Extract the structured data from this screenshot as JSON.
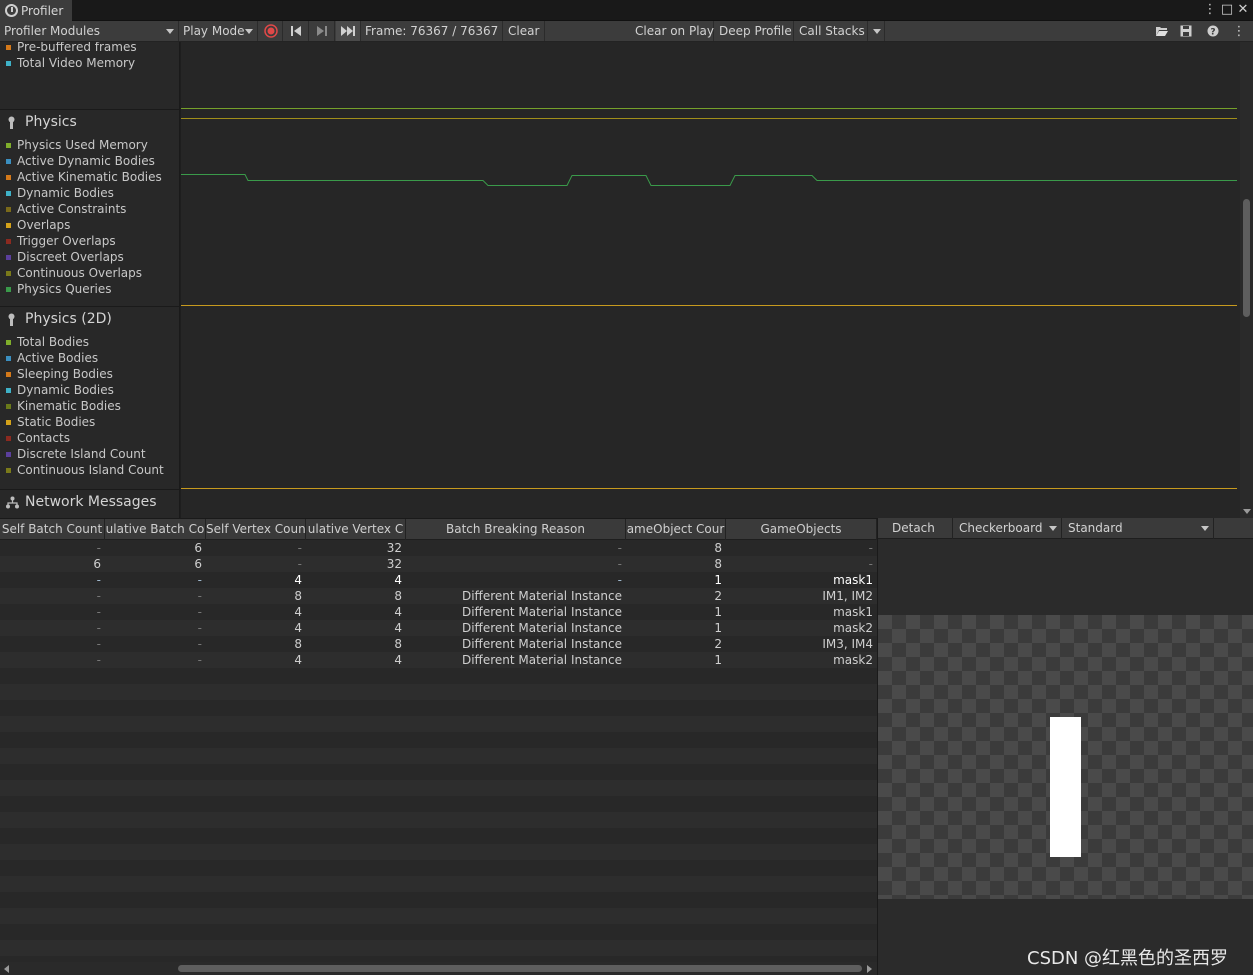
{
  "window": {
    "title": "Profiler"
  },
  "toolbar": {
    "modules_label": "Profiler Modules",
    "play_mode_label": "Play Mode",
    "frame_label": "Frame: 76367 / 76367",
    "clear_label": "Clear",
    "clear_on_play_label": "Clear on Play",
    "deep_profile_label": "Deep Profile",
    "call_stacks_label": "Call Stacks"
  },
  "legend": {
    "video": {
      "items": [
        {
          "label": "Pre-buffered frames",
          "color": "#d4791a"
        },
        {
          "label": "Total Video Memory",
          "color": "#3fb2c8"
        }
      ]
    },
    "physics": {
      "title": "Physics",
      "items": [
        {
          "label": "Physics Used Memory",
          "color": "#7fae2b"
        },
        {
          "label": "Active Dynamic Bodies",
          "color": "#3b8fc0"
        },
        {
          "label": "Active Kinematic Bodies",
          "color": "#d4791a"
        },
        {
          "label": "Dynamic Bodies",
          "color": "#3fb2c8"
        },
        {
          "label": "Active Constraints",
          "color": "#7a6a1a"
        },
        {
          "label": "Overlaps",
          "color": "#d4a21a"
        },
        {
          "label": "Trigger Overlaps",
          "color": "#8c2a20"
        },
        {
          "label": "Discreet Overlaps",
          "color": "#5b3f9c"
        },
        {
          "label": "Continuous Overlaps",
          "color": "#7a7a1a"
        },
        {
          "label": "Physics Queries",
          "color": "#3a9a4a"
        }
      ]
    },
    "physics2d": {
      "title": "Physics (2D)",
      "items": [
        {
          "label": "Total Bodies",
          "color": "#7fae2b"
        },
        {
          "label": "Active Bodies",
          "color": "#3b8fc0"
        },
        {
          "label": "Sleeping Bodies",
          "color": "#d4791a"
        },
        {
          "label": "Dynamic Bodies",
          "color": "#3fb2c8"
        },
        {
          "label": "Kinematic Bodies",
          "color": "#6a7a1a"
        },
        {
          "label": "Static Bodies",
          "color": "#d4a21a"
        },
        {
          "label": "Contacts",
          "color": "#8c2a20"
        },
        {
          "label": "Discrete Island Count",
          "color": "#5b3f9c"
        },
        {
          "label": "Continuous Island Count",
          "color": "#7a7a1a"
        }
      ]
    },
    "network": {
      "title": "Network Messages"
    }
  },
  "table": {
    "columns": [
      "Self Batch Count",
      "Cumulative Batch Count",
      "Self Vertex Count",
      "Cumulative Vertex Count",
      "Batch Breaking Reason",
      "GameObject Count",
      "GameObjects"
    ],
    "columns_visible": [
      "Self Batch Count",
      "ulative Batch Co",
      "Self Vertex Coun",
      "ulative Vertex C",
      "Batch Breaking Reason",
      "ameObject Cour",
      "GameObjects"
    ],
    "selected_row": 2,
    "rows": [
      [
        "-",
        "6",
        "-",
        "32",
        "-",
        "8",
        "-"
      ],
      [
        "6",
        "6",
        "-",
        "32",
        "-",
        "8",
        "-"
      ],
      [
        "-",
        "-",
        "4",
        "4",
        "-",
        "1",
        "mask1"
      ],
      [
        "-",
        "-",
        "8",
        "8",
        "Different Material Instance",
        "2",
        "IM1, IM2"
      ],
      [
        "-",
        "-",
        "4",
        "4",
        "Different Material Instance",
        "1",
        "mask1"
      ],
      [
        "-",
        "-",
        "4",
        "4",
        "Different Material Instance",
        "1",
        "mask2"
      ],
      [
        "-",
        "-",
        "8",
        "8",
        "Different Material Instance",
        "2",
        "IM3, IM4"
      ],
      [
        "-",
        "-",
        "4",
        "4",
        "Different Material Instance",
        "1",
        "mask2"
      ]
    ]
  },
  "preview": {
    "detach_label": "Detach",
    "background_label": "Checkerboard",
    "shader_label": "Standard"
  },
  "watermark": "CSDN @红黑色的圣西罗"
}
